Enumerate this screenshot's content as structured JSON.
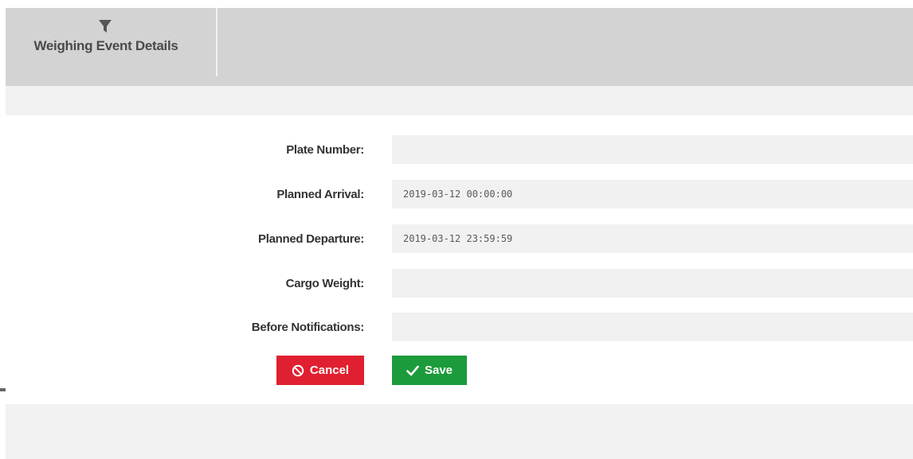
{
  "header": {
    "tab_title": "Weighing Event Details",
    "tab_icon": "filter-icon"
  },
  "form": {
    "fields": [
      {
        "label": "Plate Number:",
        "value": "",
        "placeholder": ""
      },
      {
        "label": "Planned Arrival:",
        "value": "2019-03-12 00:00:00",
        "placeholder": ""
      },
      {
        "label": "Planned Departure:",
        "value": "2019-03-12 23:59:59",
        "placeholder": ""
      },
      {
        "label": "Cargo Weight:",
        "value": "",
        "placeholder": ""
      },
      {
        "label": "Before Notifications:",
        "value": "",
        "placeholder": ""
      }
    ]
  },
  "actions": {
    "cancel_label": "Cancel",
    "cancel_icon": "ban-icon",
    "cancel_color": "#e02030",
    "save_label": "Save",
    "save_icon": "check-icon",
    "save_color": "#1b9b3b"
  }
}
